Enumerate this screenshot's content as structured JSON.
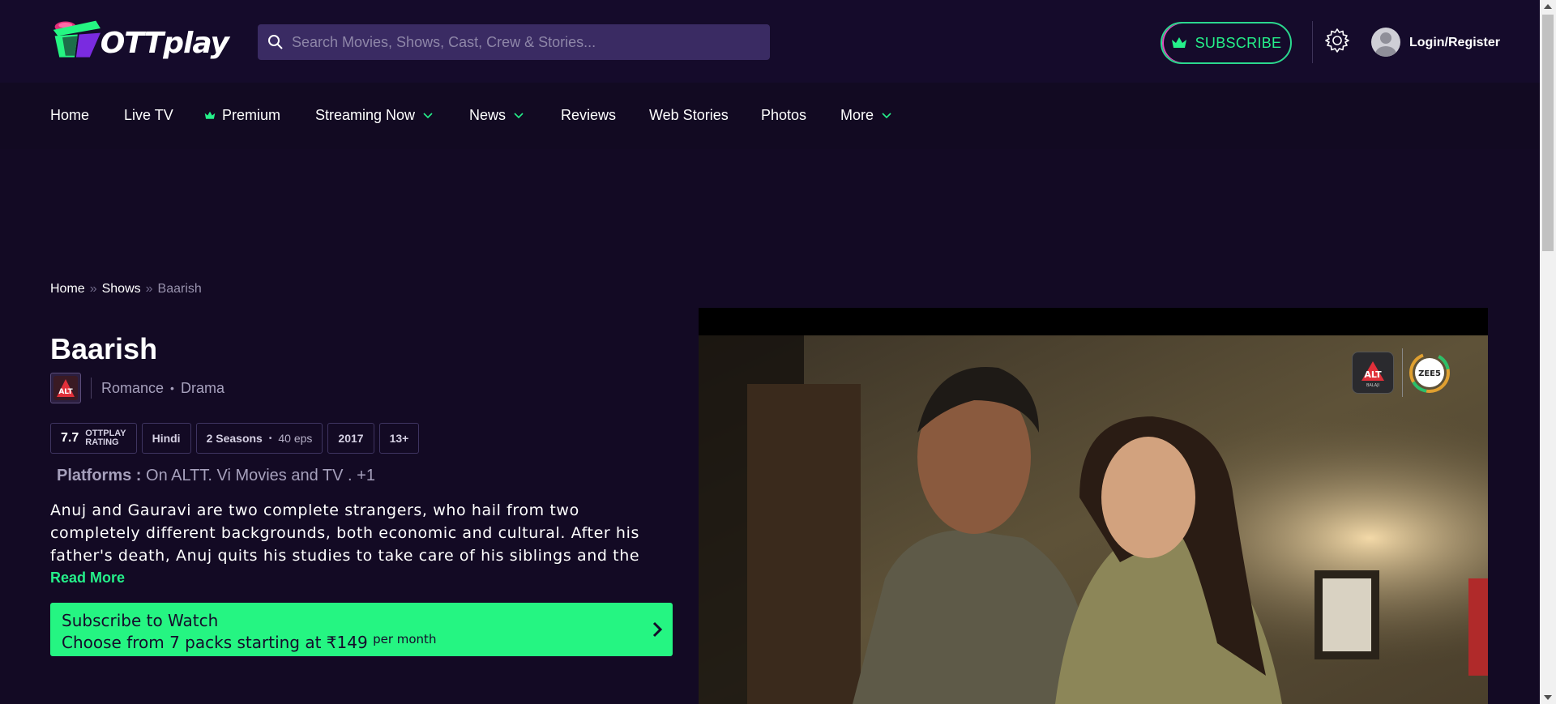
{
  "header": {
    "logo_text": "OTTplay",
    "search_placeholder": "Search Movies, Shows, Cast, Crew & Stories...",
    "subscribe_label": "SUBSCRIBE",
    "login_label": "Login/Register"
  },
  "nav": {
    "items": [
      {
        "label": "Home"
      },
      {
        "label": "Live TV"
      },
      {
        "label": "Premium"
      },
      {
        "label": "Streaming Now"
      },
      {
        "label": "News"
      },
      {
        "label": "Reviews"
      },
      {
        "label": "Web Stories"
      },
      {
        "label": "Photos"
      },
      {
        "label": "More"
      }
    ]
  },
  "breadcrumb": {
    "home": "Home",
    "sep": "»",
    "shows": "Shows",
    "current": "Baarish"
  },
  "show": {
    "title": "Baarish",
    "provider_logo_text": "ALT",
    "genres": [
      "Romance",
      "Drama"
    ],
    "rating": "7.7",
    "rating_label_1": "OTTPLAY",
    "rating_label_2": "RATING",
    "language": "Hindi",
    "seasons": "2 Seasons",
    "episodes": "40 eps",
    "year": "2017",
    "age": "13+",
    "platforms_label": "Platforms :",
    "platforms_value": "On ALTT. Vi Movies and TV . +1",
    "synopsis": "Anuj and Gauravi are two complete strangers, who hail from two completely different backgrounds, both economic and cultural. After his father's death, Anuj quits his studies to take care of his siblings and the",
    "read_more": "Read More"
  },
  "cta": {
    "line1": "Subscribe to Watch",
    "line2": "Choose from 7 packs starting at ₹149",
    "per": "per month"
  },
  "player": {
    "badge_alt": "ALT",
    "badge_balaji": "BALAJI",
    "badge_zee": "ZEE5"
  },
  "colors": {
    "background": "#130a24",
    "accent_green": "#25f582",
    "search_bg": "#3a2b63"
  }
}
